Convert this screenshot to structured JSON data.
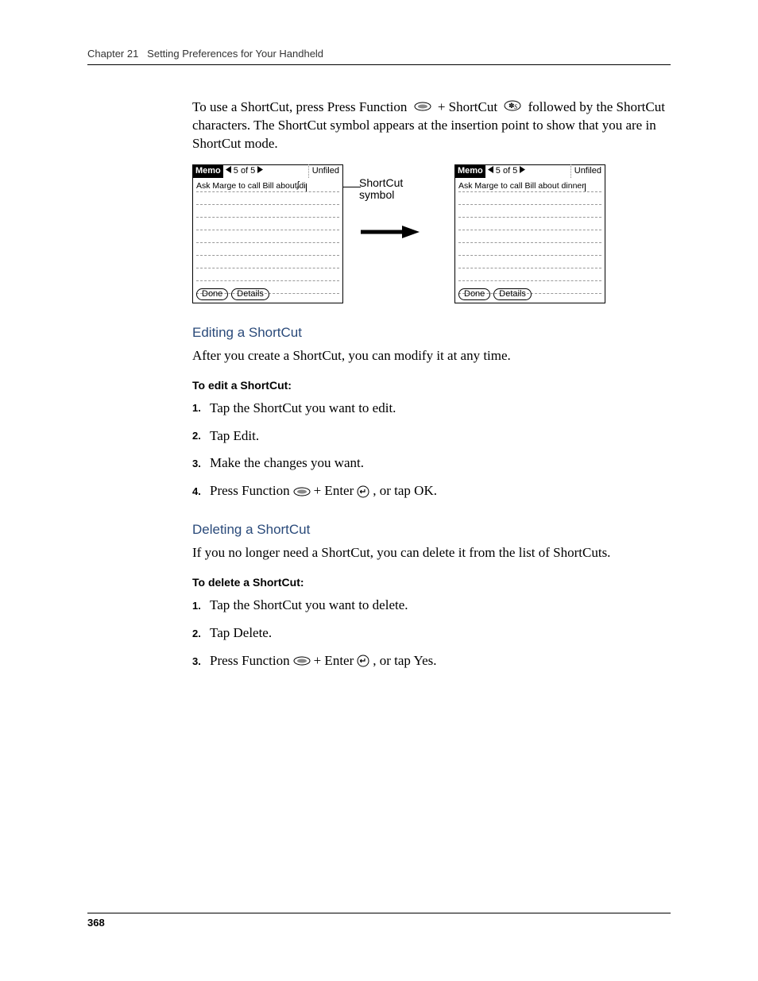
{
  "header": {
    "chapter": "Chapter 21",
    "title": "Setting Preferences for Your Handheld"
  },
  "intro_text_1": "To use a ShortCut, press Press Function ",
  "intro_text_2": " + ShortCut ",
  "intro_text_3": " followed by the ShortCut characters. The ShortCut symbol appears at the insertion point to show that you are in ShortCut mode.",
  "figure": {
    "memo_title": "Memo",
    "nav": "5 of 5",
    "category": "Unfiled",
    "left_text": "Ask Marge to call Bill about ",
    "left_shortcut_tail": "di",
    "right_text": "Ask Marge to call Bill about dinner",
    "done": "Done",
    "details": "Details",
    "callout": "ShortCut symbol"
  },
  "sections": {
    "edit": {
      "head": "Editing a ShortCut",
      "intro": "After you create a ShortCut, you can modify it at any time.",
      "sub": "To edit a ShortCut:",
      "steps": [
        "Tap the ShortCut you want to edit.",
        "Tap Edit.",
        "Make the changes you want.",
        {
          "pre": "Press Function ",
          "mid": " + Enter ",
          "post": ", or tap OK."
        }
      ]
    },
    "del": {
      "head": "Deleting a ShortCut",
      "intro": "If you no longer need a ShortCut, you can delete it from the list of ShortCuts.",
      "sub": "To delete a ShortCut:",
      "steps": [
        "Tap the ShortCut you want to delete.",
        "Tap Delete.",
        {
          "pre": "Press Function ",
          "mid": " + Enter ",
          "post": ", or tap Yes."
        }
      ]
    }
  },
  "page_number": "368"
}
